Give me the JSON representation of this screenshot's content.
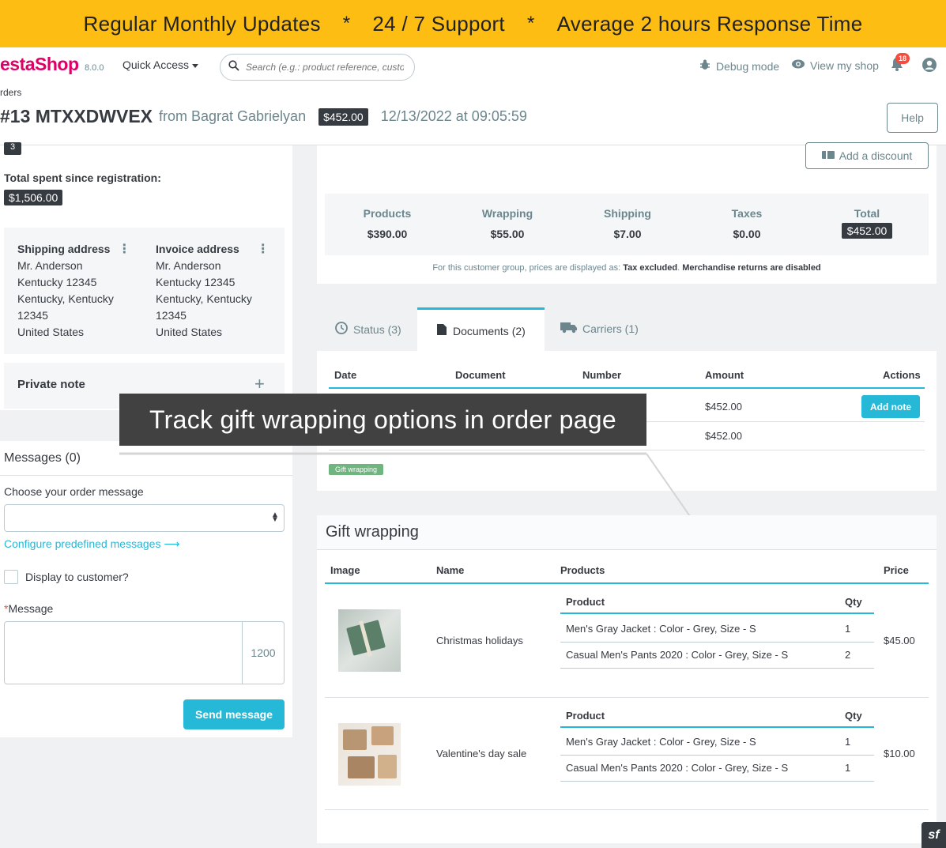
{
  "promo": {
    "part1": "Regular Monthly Updates",
    "sep": "*",
    "part2": "24 / 7 Support",
    "part3": "Average 2 hours Response Time"
  },
  "header": {
    "logo": "estaShop",
    "version": "8.0.0",
    "quick_access": "Quick Access",
    "search_placeholder": "Search (e.g.: product reference, custon",
    "debug_mode": "Debug mode",
    "view_shop": "View my shop",
    "notifications_count": "18"
  },
  "breadcrumb": "rders",
  "order": {
    "number": "#13 MTXXDWVEX",
    "from": "from Bagrat Gabrielyan",
    "total": "$452.00",
    "date": "12/13/2022 at 09:05:59",
    "help": "Help"
  },
  "customer": {
    "orders_count": "3",
    "spent_label": "Total spent since registration:",
    "spent_value": "$1,506.00",
    "shipping_title": "Shipping address",
    "invoice_title": "Invoice address",
    "shipping_lines": [
      "Mr. Anderson",
      "Kentucky 12345",
      "Kentucky, Kentucky",
      "12345",
      "United States"
    ],
    "invoice_lines": [
      "Mr. Anderson",
      "Kentucky 12345",
      "Kentucky, Kentucky",
      "12345",
      "United States"
    ],
    "private_note": "Private note"
  },
  "messages": {
    "title": "Messages (0)",
    "choose_label": "Choose your order message",
    "configure_link": "Configure predefined messages",
    "display_label": "Display to customer?",
    "message_label": "Message",
    "required_mark": "*",
    "char_count": "1200",
    "send_button": "Send message"
  },
  "totals": {
    "add_discount": "Add a discount",
    "columns": [
      {
        "label": "Products",
        "value": "$390.00"
      },
      {
        "label": "Wrapping",
        "value": "$55.00"
      },
      {
        "label": "Shipping",
        "value": "$7.00"
      },
      {
        "label": "Taxes",
        "value": "$0.00"
      },
      {
        "label": "Total",
        "value": "$452.00"
      }
    ],
    "note_prefix": "For this customer group, prices are displayed as: ",
    "note_bold1": "Tax excluded",
    "note_sep": ". ",
    "note_bold2": "Merchandise returns are disabled"
  },
  "tabs": [
    {
      "label": "Status (3)"
    },
    {
      "label": "Documents (2)"
    },
    {
      "label": "Carriers (1)"
    }
  ],
  "documents": {
    "headers": [
      "Date",
      "Document",
      "Number",
      "Amount",
      "Actions"
    ],
    "rows": [
      {
        "amount": "$452.00",
        "action": "Add note"
      },
      {
        "amount": "$452.00"
      }
    ],
    "gift_badge": "Gift wrapping"
  },
  "overlay_text": "Track gift wrapping options in order page",
  "gift_wrapping": {
    "title": "Gift wrapping",
    "headers": [
      "Image",
      "Name",
      "Products",
      "Price"
    ],
    "product_header": "Product",
    "qty_header": "Qty",
    "items": [
      {
        "name": "Christmas holidays",
        "price": "$45.00",
        "products": [
          {
            "product": "Men's Gray Jacket : Color - Grey, Size - S",
            "qty": "1"
          },
          {
            "product": "Casual Men's Pants 2020 : Color - Grey, Size - S",
            "qty": "2"
          }
        ]
      },
      {
        "name": "Valentine's day sale",
        "price": "$10.00",
        "products": [
          {
            "product": "Men's Gray Jacket : Color - Grey, Size - S",
            "qty": "1"
          },
          {
            "product": "Casual Men's Pants 2020 : Color - Grey, Size - S",
            "qty": "1"
          }
        ]
      }
    ]
  },
  "colors": {
    "promo_bg": "#fdbd13",
    "accent": "#25b9d7",
    "brand": "#df0067",
    "dark": "#363a41",
    "success": "#70b580"
  }
}
